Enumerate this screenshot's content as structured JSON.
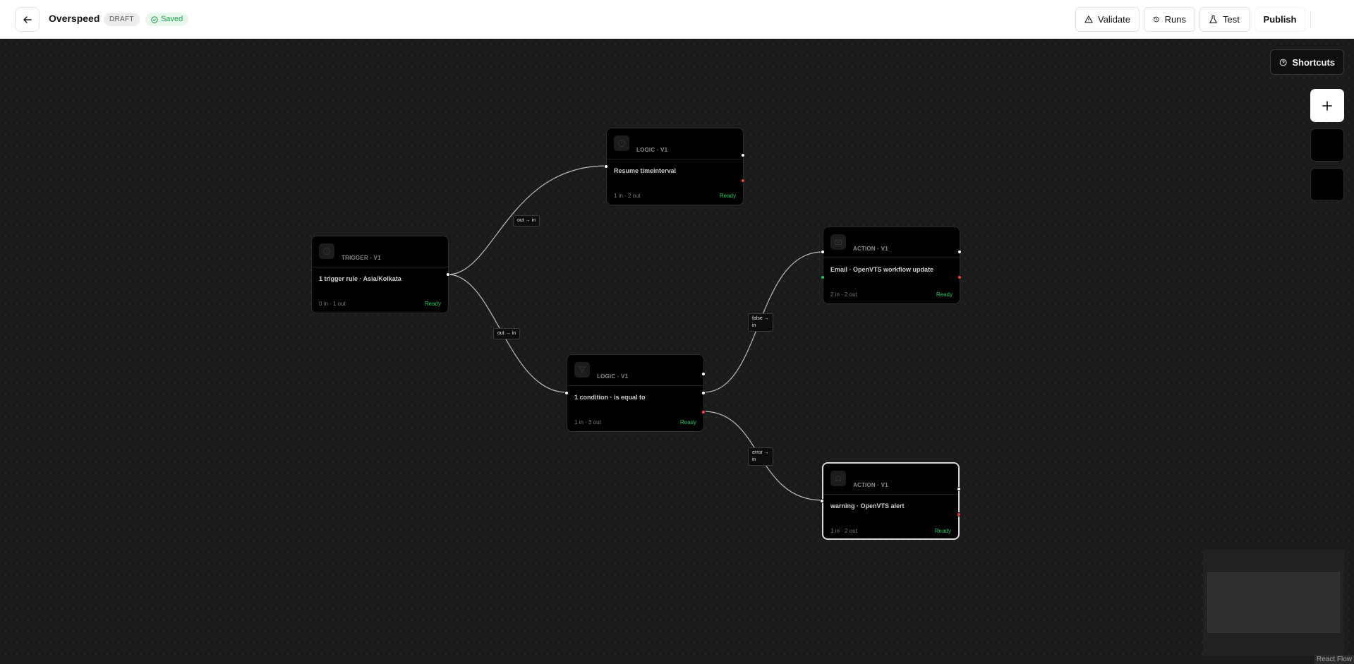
{
  "header": {
    "back_icon": "arrow-left-icon",
    "title": "Overspeed",
    "status_badge": "DRAFT",
    "saved_label": "Saved",
    "saved_icon": "check-circle-icon",
    "buttons": {
      "validate": "Validate",
      "runs": "Runs",
      "test": "Test",
      "publish": "Publish"
    }
  },
  "canvas": {
    "shortcuts_label": "Shortcuts",
    "add_node_icon": "plus-icon",
    "attribution": "React Flow"
  },
  "edges": {
    "e1": "out → in",
    "e2": "out → in",
    "e3": "false →\nin",
    "e4": "error →\nin"
  },
  "nodes": {
    "trigger": {
      "type": "TRIGGER · V1",
      "title": "1 trigger rule · Asia/Kolkata",
      "io": "0 in · 1 out",
      "status": "Ready",
      "icon": "clock-icon"
    },
    "resume": {
      "type": "LOGIC · V1",
      "title": "Resume timeinterval",
      "io": "1 in · 2 out",
      "status": "Ready",
      "icon": "timer-icon"
    },
    "condition": {
      "type": "LOGIC · V1",
      "title": "1 condition · is equal to",
      "io": "1 in · 3 out",
      "status": "Ready",
      "icon": "filter-icon"
    },
    "email": {
      "type": "ACTION · V1",
      "title": "Email · OpenVTS workflow update",
      "io": "2 in · 2 out",
      "status": "Ready",
      "icon": "mail-icon"
    },
    "warning": {
      "type": "ACTION · V1",
      "title": "warning · OpenVTS alert",
      "io": "1 in · 2 out",
      "status": "Ready",
      "icon": "bell-icon"
    }
  },
  "colors": {
    "ready": "#22c55e",
    "error_handle": "#ef4444",
    "canvas_bg": "#1b1b1b"
  }
}
